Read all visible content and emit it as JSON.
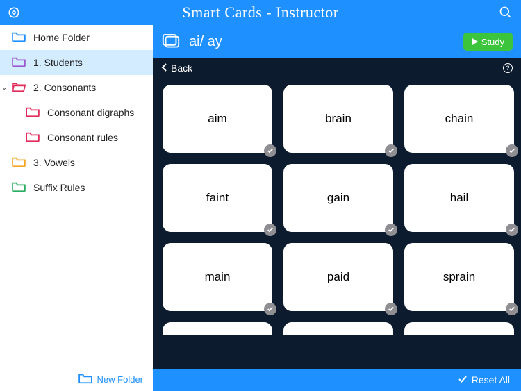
{
  "header": {
    "title": "Smart Cards - Instructor"
  },
  "sidebar": {
    "items": [
      {
        "label": "Home Folder",
        "color": "#1e90ff",
        "indent": 0,
        "open": false,
        "caret": false,
        "selected": false
      },
      {
        "label": "1. Students",
        "color": "#9b59d0",
        "indent": 0,
        "open": false,
        "caret": false,
        "selected": true
      },
      {
        "label": "2. Consonants",
        "color": "#e22a5b",
        "indent": 0,
        "open": true,
        "caret": true,
        "selected": false
      },
      {
        "label": "Consonant digraphs",
        "color": "#e22a5b",
        "indent": 1,
        "open": false,
        "caret": false,
        "selected": false
      },
      {
        "label": "Consonant rules",
        "color": "#e22a5b",
        "indent": 1,
        "open": false,
        "caret": false,
        "selected": false
      },
      {
        "label": "3. Vowels",
        "color": "#f5a623",
        "indent": 0,
        "open": false,
        "caret": false,
        "selected": false
      },
      {
        "label": "Suffix Rules",
        "color": "#27ae60",
        "indent": 0,
        "open": false,
        "caret": false,
        "selected": false
      }
    ],
    "new_folder_label": "New Folder"
  },
  "deck": {
    "title": "ai/ ay",
    "study_label": "Study",
    "back_label": "Back",
    "reset_label": "Reset All",
    "cards": [
      "aim",
      "brain",
      "chain",
      "faint",
      "gain",
      "hail",
      "main",
      "paid",
      "sprain"
    ]
  }
}
